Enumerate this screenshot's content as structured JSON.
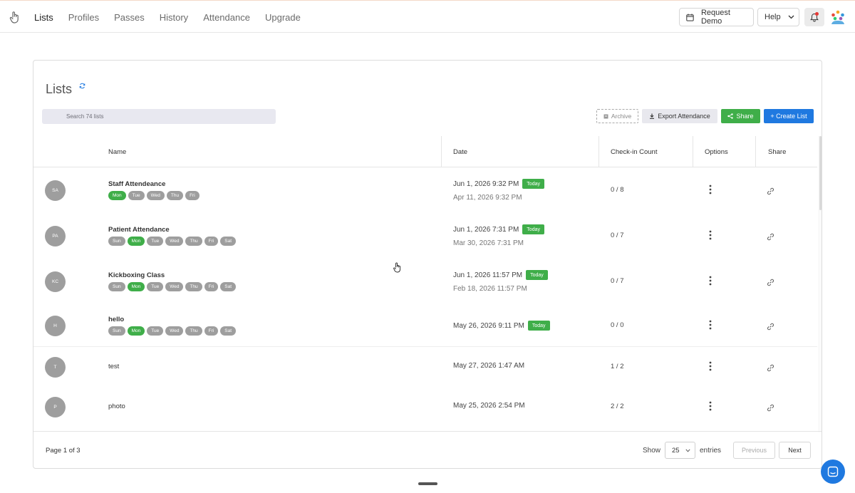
{
  "nav": {
    "items": [
      {
        "label": "Lists",
        "active": true
      },
      {
        "label": "Profiles",
        "active": false
      },
      {
        "label": "Passes",
        "active": false
      },
      {
        "label": "History",
        "active": false
      },
      {
        "label": "Attendance",
        "active": false
      },
      {
        "label": "Upgrade",
        "active": false
      }
    ],
    "request_demo": "Request Demo",
    "help": "Help",
    "icons": [
      "hand-logo-icon",
      "calendar-icon",
      "chevron-down-icon",
      "bell-icon",
      "avatar-icon"
    ]
  },
  "page": {
    "title": "Lists",
    "search_placeholder": "Search 74 lists",
    "archive": "Archive",
    "export": "Export Attendance",
    "share": "Share",
    "create": "+ Create List"
  },
  "table": {
    "headers": [
      "Name",
      "Date",
      "Check-in Count",
      "Options",
      "Share"
    ],
    "rows": [
      {
        "initials": "SA",
        "name": "Staff Attendeance",
        "bold": true,
        "days": [
          {
            "d": "Mon",
            "on": true
          },
          {
            "d": "Tue",
            "on": false
          },
          {
            "d": "Wed",
            "on": false
          },
          {
            "d": "Thu",
            "on": false
          },
          {
            "d": "Fri",
            "on": false
          }
        ],
        "date1": "Jun 1, 2026 9:32 PM",
        "today": "Today",
        "date2": "Apr 11, 2026 9:32 PM",
        "count": "0 / 8"
      },
      {
        "initials": "PA",
        "name": "Patient Attendance",
        "bold": true,
        "days": [
          {
            "d": "Sun",
            "on": false
          },
          {
            "d": "Mon",
            "on": true
          },
          {
            "d": "Tue",
            "on": false
          },
          {
            "d": "Wed",
            "on": false
          },
          {
            "d": "Thu",
            "on": false
          },
          {
            "d": "Fri",
            "on": false
          },
          {
            "d": "Sat",
            "on": false
          }
        ],
        "date1": "Jun 1, 2026 7:31 PM",
        "today": "Today",
        "date2": "Mar 30, 2026 7:31 PM",
        "count": "0 / 7"
      },
      {
        "initials": "KC",
        "name": "Kickboxing Class",
        "bold": true,
        "days": [
          {
            "d": "Sun",
            "on": false
          },
          {
            "d": "Mon",
            "on": true
          },
          {
            "d": "Tue",
            "on": false
          },
          {
            "d": "Wed",
            "on": false
          },
          {
            "d": "Thu",
            "on": false
          },
          {
            "d": "Fri",
            "on": false
          },
          {
            "d": "Sat",
            "on": false
          }
        ],
        "date1": "Jun 1, 2026 11:57 PM",
        "today": "Today",
        "date2": "Feb 18, 2026 11:57 PM",
        "count": "0 / 7"
      },
      {
        "initials": "H",
        "name": "hello",
        "bold": true,
        "days": [
          {
            "d": "Sun",
            "on": false
          },
          {
            "d": "Mon",
            "on": true
          },
          {
            "d": "Tue",
            "on": false
          },
          {
            "d": "Wed",
            "on": false
          },
          {
            "d": "Thu",
            "on": false
          },
          {
            "d": "Fri",
            "on": false
          },
          {
            "d": "Sat",
            "on": false
          }
        ],
        "date1": "May 26, 2026 9:11 PM",
        "today": "Today",
        "date2": "",
        "count": "0 / 0"
      },
      {
        "initials": "T",
        "name": "test",
        "bold": false,
        "days": [],
        "date1": "May 27, 2026 1:47 AM",
        "today": "",
        "date2": "",
        "count": "1 / 2"
      },
      {
        "initials": "P",
        "name": "photo",
        "bold": false,
        "days": [],
        "date1": "May 25, 2026 2:54 PM",
        "today": "",
        "date2": "",
        "count": "2 / 2"
      }
    ]
  },
  "footer": {
    "page_info": "Page 1 of 3",
    "show": "Show",
    "page_size": "25",
    "entries": "entries",
    "previous": "Previous",
    "next": "Next"
  },
  "colors": {
    "green": "#3fae49",
    "blue": "#1f79e0",
    "gray_badge": "#9e9e9e"
  }
}
